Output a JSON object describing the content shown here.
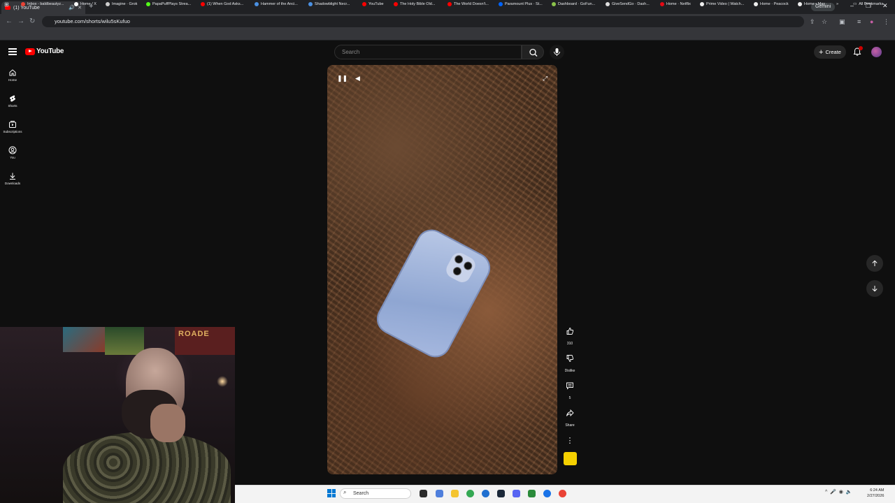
{
  "browser": {
    "tab_title": "(1) YouTube",
    "new_tab": "+",
    "gemini_label": "Gemini",
    "url": "youtube.com/shorts/wilu5sKufuo",
    "controls": {
      "minimize": "–",
      "restore": "❐",
      "close": "✕"
    },
    "bookmarks": [
      {
        "label": "Inbox - baldbeautyz...",
        "color": "#ea4335"
      },
      {
        "label": "Home / X",
        "color": "#ffffff"
      },
      {
        "label": "Imagine · Grok",
        "color": "#cccccc"
      },
      {
        "label": "PapaPuffPlays Strea...",
        "color": "#53fc18"
      },
      {
        "label": "(1) When God Asks...",
        "color": "#ff0000"
      },
      {
        "label": "Hammer of the Anci...",
        "color": "#4a90e2"
      },
      {
        "label": "Shadowblight Necr...",
        "color": "#4a90e2"
      },
      {
        "label": "YouTube",
        "color": "#ff0000"
      },
      {
        "label": "The Holy Bible Old...",
        "color": "#ff0000"
      },
      {
        "label": "The World Doesn't...",
        "color": "#ff0000"
      },
      {
        "label": "Paramount Plus · St...",
        "color": "#0064ff"
      },
      {
        "label": "Dashboard · GoFun...",
        "color": "#8bc34a"
      },
      {
        "label": "GiveSendGo · Dash...",
        "color": "#dddddd"
      },
      {
        "label": "Home · Netflix",
        "color": "#e50914"
      },
      {
        "label": "Prime Video | Watch...",
        "color": "#eeeeee"
      },
      {
        "label": "Home · Peacock",
        "color": "#eeeeee"
      },
      {
        "label": "Home • Max",
        "color": "#eeeeee"
      }
    ],
    "all_bookmarks": "All Bookmarks"
  },
  "youtube": {
    "logo_text": "YouTube",
    "search_placeholder": "Search",
    "create_label": "Create",
    "sidebar": [
      {
        "label": "Home",
        "icon": "home-icon"
      },
      {
        "label": "Shorts",
        "icon": "shorts-icon"
      },
      {
        "label": "Subscriptions",
        "icon": "subscriptions-icon"
      },
      {
        "label": "You",
        "icon": "you-icon"
      },
      {
        "label": "Downloads",
        "icon": "downloads-icon"
      }
    ],
    "actions": {
      "like_count": "310",
      "dislike_label": "Dislike",
      "comment_count": "5",
      "share_label": "Share"
    }
  },
  "webcam": {
    "poster_text": "ROADE"
  },
  "taskbar": {
    "search_label": "Search",
    "time": "6:24 AM",
    "date": "2/27/2026"
  },
  "colors": {
    "youtube_red": "#ff0000",
    "background": "#0f0f0f",
    "windows_blue": "#0078d4"
  }
}
